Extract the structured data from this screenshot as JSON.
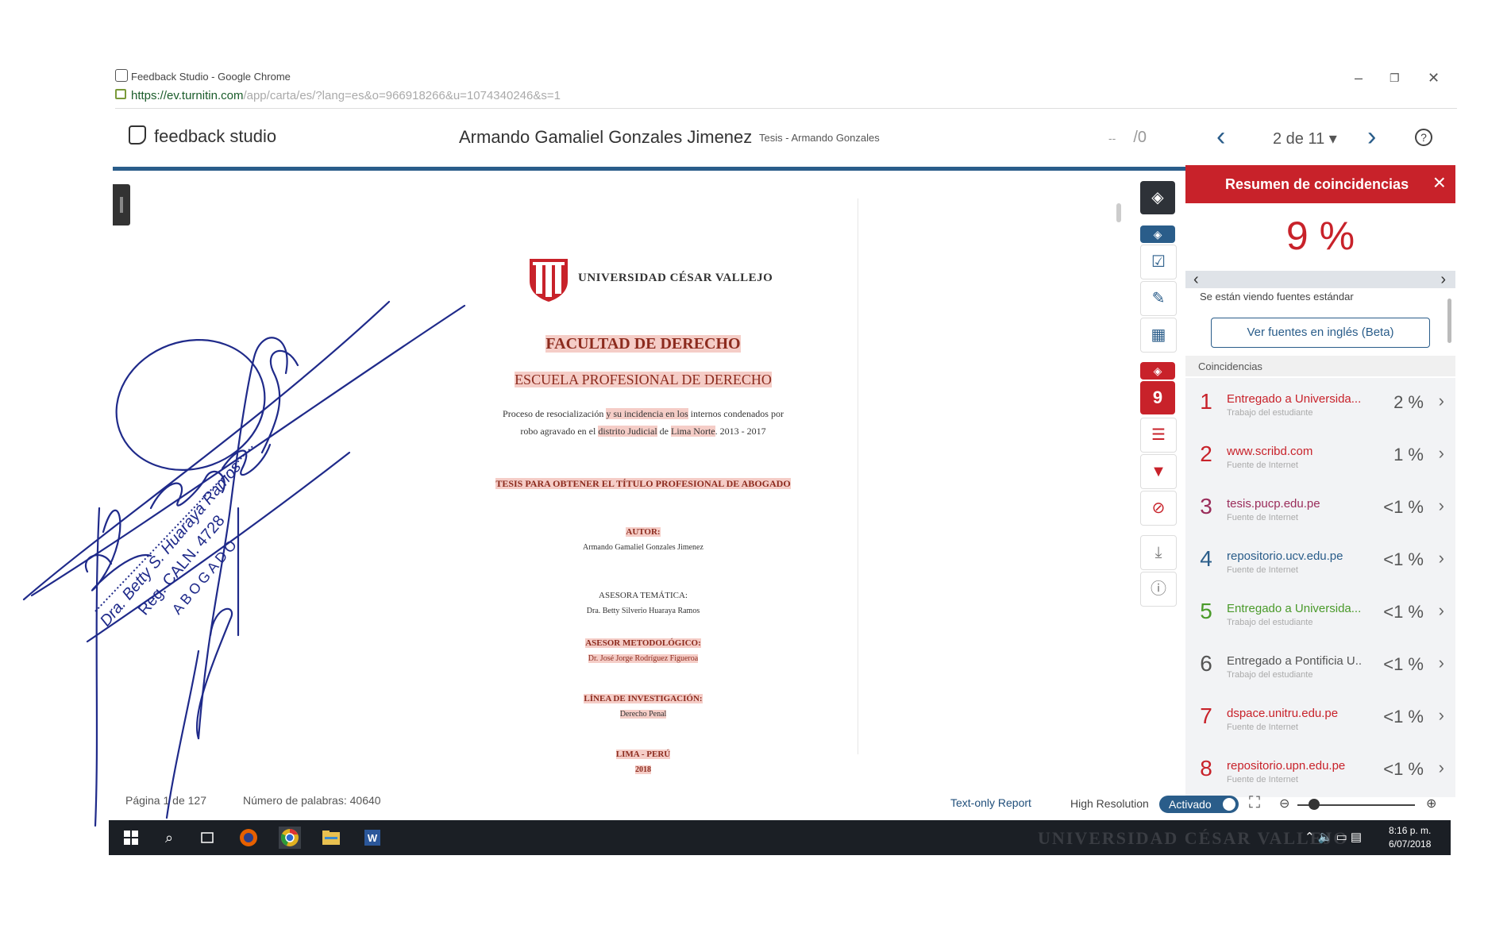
{
  "window": {
    "title": "Feedback Studio - Google Chrome",
    "url_domain": "https://ev.turnitin.com",
    "url_path": "/app/carta/es/?lang=es&o=966918266&u=1074340246&s=1"
  },
  "header": {
    "logo_text": "feedback studio",
    "student_name": "Armando Gamaliel Gonzales Jimenez",
    "document_title": "Tesis - Armando Gonzales",
    "grade_dash": "--",
    "grade_total": "/0",
    "page_selector": "2 de 11"
  },
  "document": {
    "university": "UNIVERSIDAD CÉSAR VALLEJO",
    "faculty": "FACULTAD DE DERECHO",
    "school": "ESCUELA PROFESIONAL DE DERECHO",
    "subject_1a": "Proceso de resocialización ",
    "subject_1b": "y su incidencia en los",
    "subject_1c": " internos condenados por",
    "subject_2a": "robo agravado en el ",
    "subject_2b": "distrito Judicial",
    "subject_2c": " de ",
    "subject_2d": "Lima Norte",
    "subject_2e": ". 2013 - 2017",
    "thesis_heading": "TESIS PARA OBTENER EL TÍTULO PROFESIONAL DE ABOGADO",
    "author_label": "AUTOR:",
    "author_name": "Armando Gamaliel Gonzales Jimenez",
    "advisor_label": "ASESORA TEMÁTICA:",
    "advisor_name": "Dra. Betty Silverio Huaraya Ramos",
    "method_label": "ASESOR METODOLÓGICO:",
    "method_name": "Dr. José Jorge Rodríguez Figueroa",
    "line_label": "LÍNEA DE INVESTIGACIÓN:",
    "line_name": "Derecho Penal",
    "place": "LIMA - PERÚ",
    "year": "2018"
  },
  "toolbar": {
    "match_count": "9"
  },
  "panel": {
    "title": "Resumen de coincidencias",
    "total": "9 %",
    "source_view": "Se están viendo fuentes estándar",
    "english_button": "Ver fuentes en inglés (Beta)",
    "matches_header": "Coincidencias",
    "matches": [
      {
        "num": "1",
        "name": "Entregado a Universida...",
        "type": "Trabajo del estudiante",
        "pct": "2 %",
        "color": "#c8222a"
      },
      {
        "num": "2",
        "name": "www.scribd.com",
        "type": "Fuente de Internet",
        "pct": "1 %",
        "color": "#c8222a"
      },
      {
        "num": "3",
        "name": "tesis.pucp.edu.pe",
        "type": "Fuente de Internet",
        "pct": "<1 %",
        "color": "#9a2c5a"
      },
      {
        "num": "4",
        "name": "repositorio.ucv.edu.pe",
        "type": "Fuente de Internet",
        "pct": "<1 %",
        "color": "#2a5d8a"
      },
      {
        "num": "5",
        "name": "Entregado a Universida...",
        "type": "Trabajo del estudiante",
        "pct": "<1 %",
        "color": "#4a9a2a"
      },
      {
        "num": "6",
        "name": "Entregado a Pontificia U...",
        "type": "Trabajo del estudiante",
        "pct": "<1 %",
        "color": "#555555"
      },
      {
        "num": "7",
        "name": "dspace.unitru.edu.pe",
        "type": "Fuente de Internet",
        "pct": "<1 %",
        "color": "#c8222a"
      },
      {
        "num": "8",
        "name": "repositorio.upn.edu.pe",
        "type": "Fuente de Internet",
        "pct": "<1 %",
        "color": "#c8222a"
      }
    ]
  },
  "status": {
    "page_count": "Página 1 de 127",
    "word_count": "Número de palabras: 40640",
    "text_only": "Text-only Report",
    "high_res": "High Resolution",
    "toggle": "Activado"
  },
  "taskbar": {
    "watermark": "UNIVERSIDAD CÉSAR VALLEJO",
    "time": "8:16 p. m.",
    "date": "6/07/2018"
  },
  "signature": {
    "stamp_line_1": "Dra. Betty S. Huaraya Ramos",
    "stamp_line_2": "Reg. CALN. 4728",
    "stamp_line_3": "ABOGADO"
  }
}
